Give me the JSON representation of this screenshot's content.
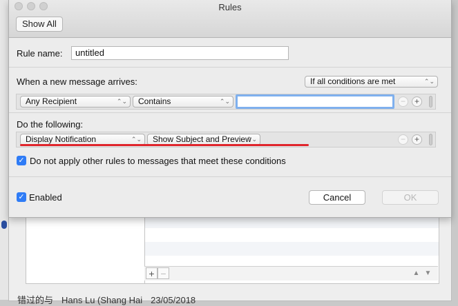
{
  "window": {
    "title": "Rules",
    "show_all_label": "Show All"
  },
  "rule_name": {
    "label": "Rule name:",
    "value": "untitled"
  },
  "conditions": {
    "header": "When a new message arrives:",
    "match_mode": "If all conditions are met",
    "rows": [
      {
        "field": "Any Recipient",
        "operator": "Contains",
        "value": ""
      }
    ]
  },
  "actions": {
    "header": "Do the following:",
    "rows": [
      {
        "action": "Display Notification",
        "option": "Show Subject and Preview"
      }
    ]
  },
  "stop_rules": {
    "checked": true,
    "label": "Do not apply other rules to messages that meet these conditions"
  },
  "enabled": {
    "checked": true,
    "label": "Enabled"
  },
  "footer_buttons": {
    "cancel": "Cancel",
    "ok": "OK"
  },
  "background": {
    "footer_text": [
      "错过的与",
      "Hans Lu (Shang Hai",
      "23/05/2018"
    ]
  },
  "colors": {
    "accent": "#2f7cf6",
    "annotation_underline": "#e0242b"
  },
  "icons": {
    "add": "+",
    "remove": "−",
    "popup_arrows": "⌃⌄",
    "check": "✓"
  }
}
